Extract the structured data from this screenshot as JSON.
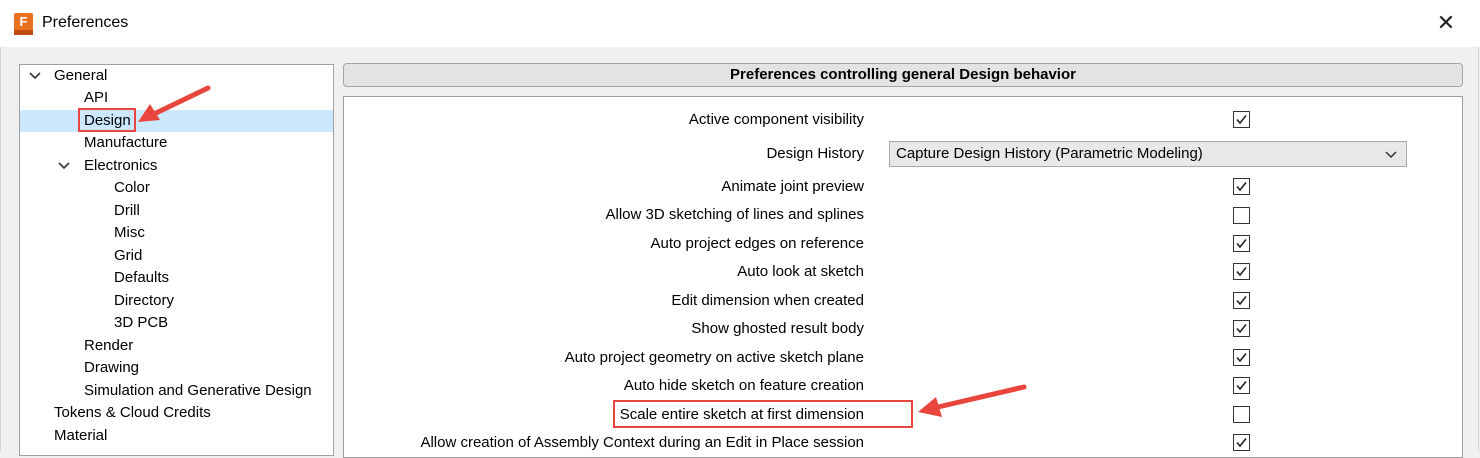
{
  "window": {
    "title": "Preferences",
    "app_icon_letter": "F",
    "close_glyph": "✕"
  },
  "tree": {
    "items": [
      {
        "label": "General",
        "expanded": true
      },
      {
        "label": "API"
      },
      {
        "label": "Design",
        "selected": true
      },
      {
        "label": "Manufacture"
      },
      {
        "label": "Electronics",
        "expanded": true
      },
      {
        "label": "Color"
      },
      {
        "label": "Drill"
      },
      {
        "label": "Misc"
      },
      {
        "label": "Grid"
      },
      {
        "label": "Defaults"
      },
      {
        "label": "Directory"
      },
      {
        "label": "3D PCB"
      },
      {
        "label": "Render"
      },
      {
        "label": "Drawing"
      },
      {
        "label": "Simulation and Generative Design"
      },
      {
        "label": "Tokens & Cloud Credits"
      },
      {
        "label": "Material"
      }
    ]
  },
  "panel": {
    "header": "Preferences controlling general Design behavior",
    "prefs": [
      {
        "label": "Active component visibility",
        "type": "checkbox",
        "checked": true
      },
      {
        "label": "Design History",
        "type": "dropdown",
        "value": "Capture Design History (Parametric Modeling)"
      },
      {
        "label": "Animate joint preview",
        "type": "checkbox",
        "checked": true
      },
      {
        "label": "Allow 3D sketching of lines and splines",
        "type": "checkbox",
        "checked": false
      },
      {
        "label": "Auto project edges on reference",
        "type": "checkbox",
        "checked": true
      },
      {
        "label": "Auto look at sketch",
        "type": "checkbox",
        "checked": true
      },
      {
        "label": "Edit dimension when created",
        "type": "checkbox",
        "checked": true
      },
      {
        "label": "Show ghosted result body",
        "type": "checkbox",
        "checked": true
      },
      {
        "label": "Auto project geometry on active sketch plane",
        "type": "checkbox",
        "checked": true
      },
      {
        "label": "Auto hide sketch on feature creation",
        "type": "checkbox",
        "checked": true
      },
      {
        "label": "Scale entire sketch at first dimension",
        "type": "checkbox",
        "checked": false
      },
      {
        "label": "Allow creation of Assembly Context during an Edit in Place session",
        "type": "checkbox",
        "checked": true
      }
    ]
  },
  "colors": {
    "annotation": "#e8453c",
    "selection": "#cce8ff",
    "brand": "#e8701f"
  },
  "icons": {
    "app": "fusion-app-icon",
    "expand": "chevron-down-icon",
    "check": "checkmark-icon",
    "dropdown": "chevron-down-icon"
  }
}
